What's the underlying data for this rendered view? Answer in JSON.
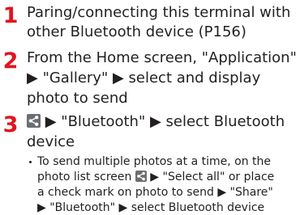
{
  "steps": [
    {
      "number": "1",
      "lines": [
        "Paring/connecting this terminal with",
        "other Bluetooth device (P156)"
      ]
    },
    {
      "number": "2",
      "lines": [
        "From the Home screen, \"Application\"",
        "▶ \"Gallery\" ▶ select and display",
        "photo to send"
      ]
    },
    {
      "number": "3",
      "line1_text": " ▶ \"Bluetooth\" ▶ select Bluetooth",
      "line2": "device",
      "icon": "share-icon",
      "note": {
        "line1": "To send multiple photos at a time, on the",
        "line2_text": "photo list screen ",
        "line2_text_after": " ▶ \"Select all\" or place",
        "line3": "a check mark on photo to send ▶ \"Share\"",
        "line4": "▶ \"Bluetooth\" ▶ select Bluetooth device"
      }
    }
  ],
  "colors": {
    "step_number": "#e3141e",
    "text": "#231f20",
    "icon_bg": "#6d6e71"
  }
}
